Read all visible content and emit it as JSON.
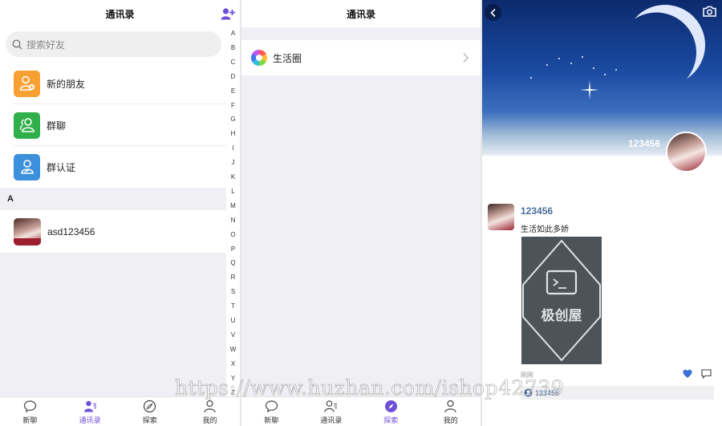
{
  "panel_contacts": {
    "title": "通讯录",
    "search_placeholder": "搜索好友",
    "items": [
      {
        "label": "新的朋友",
        "icon": "new-friend-icon",
        "color": "#f7a034"
      },
      {
        "label": "群聊",
        "icon": "group-chat-icon",
        "color": "#2fb04a"
      },
      {
        "label": "群认证",
        "icon": "group-verify-icon",
        "color": "#3d90db"
      }
    ],
    "section_letter": "A",
    "contact_name": "asd123456",
    "alphabet": [
      "A",
      "B",
      "C",
      "D",
      "E",
      "F",
      "G",
      "H",
      "I",
      "J",
      "K",
      "L",
      "M",
      "N",
      "O",
      "P",
      "Q",
      "R",
      "S",
      "T",
      "U",
      "V",
      "W",
      "X",
      "Y",
      "Z"
    ]
  },
  "panel_discover": {
    "title": "通讯录",
    "moments_label": "生活圈"
  },
  "tabs": [
    {
      "label": "新聊",
      "icon": "chat-bubble-icon"
    },
    {
      "label": "通讯录",
      "icon": "contacts-icon"
    },
    {
      "label": "探索",
      "icon": "compass-icon"
    },
    {
      "label": "我的",
      "icon": "user-icon"
    }
  ],
  "tab_active_color": "#6e4fd8",
  "panel_moments": {
    "cover_name": "123456",
    "post": {
      "author": "123456",
      "text": "生活如此多娇",
      "image_brand": "极创屋",
      "time": "刚刚",
      "likes": "123456"
    },
    "link_color": "#4b6d9b"
  },
  "watermark": "https://www.huzhan.com/ishop42739"
}
